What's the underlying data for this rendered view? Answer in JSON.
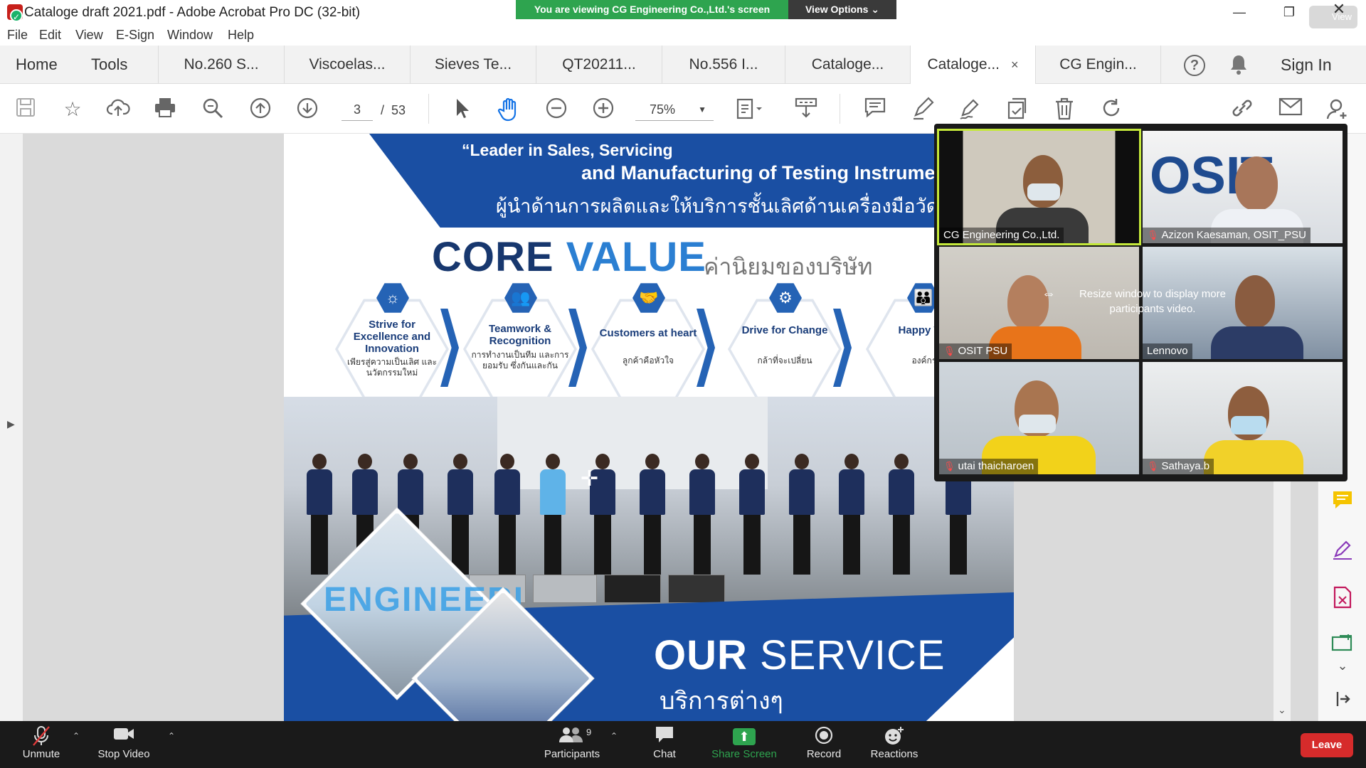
{
  "window": {
    "title": "Cataloge draft 2021.pdf - Adobe Acrobat Pro DC (32-bit)",
    "view_label": "View"
  },
  "zoom_banner": {
    "viewing_text": "You are viewing CG Engineering Co.,Ltd.'s screen",
    "view_options_label": "View Options ⌄"
  },
  "menu": [
    "File",
    "Edit",
    "View",
    "E-Sign",
    "Window",
    "Help"
  ],
  "tabs": {
    "home": "Home",
    "tools": "Tools",
    "documents": [
      "No.260 S...",
      "Viscoelas...",
      "Sieves Te...",
      "QT20211...",
      "No.556 I...",
      "Cataloge...",
      "Cataloge...",
      "CG Engin..."
    ],
    "active_index": 6,
    "close_symbol": "×",
    "sign_in": "Sign In"
  },
  "toolbar": {
    "current_page": "3",
    "page_separator": "/",
    "total_pages": "53",
    "zoom_level": "75%"
  },
  "pdf": {
    "slogan_line1": "“Leader in Sales, Servicing",
    "slogan_line2": "and Manufacturing of Testing Instrume",
    "slogan_thai": "ผู้นำด้านการผลิตและให้บริการชั้นเลิศด้านเครื่องมือวัดทดสอบ",
    "core_word1": "CORE",
    "core_word2": "VALUE",
    "core_thai": "ค่านิยมของบริษัท",
    "values": [
      {
        "title": "Strive for Excellence and Innovation",
        "thai": "เพียรสู่ความเป็นเลิศ และนวัตกรรมใหม่"
      },
      {
        "title": "Teamwork & Recognition",
        "thai": "การทำงานเป็นทีม และการยอมรับ ซึ่งกันและกัน"
      },
      {
        "title": "Customers at heart",
        "thai": "ลูกค้าคือหัวใจ"
      },
      {
        "title": "Drive for Change",
        "thai": "กล้าที่จะเปลี่ยน"
      },
      {
        "title": "Happy Workpla",
        "thai": "องค์กรแห่งคว"
      }
    ],
    "engi_text": "ENGINEERI",
    "our_word": "OUR",
    "service_word": "SERVICE",
    "service_thai": "บริการต่างๆ"
  },
  "zoom_gallery": {
    "participants": [
      {
        "name": "CG Engineering Co.,Ltd.",
        "muted": false,
        "speaking": true
      },
      {
        "name": "Azizon Kaesaman, OSIT_PSU",
        "muted": true,
        "speaking": false
      },
      {
        "name": "OSIT PSU",
        "muted": true,
        "speaking": false
      },
      {
        "name": "Lennovo",
        "muted": false,
        "speaking": false
      },
      {
        "name": "utai thaicharoen",
        "muted": true,
        "speaking": false
      },
      {
        "name": "Sathaya.b",
        "muted": true,
        "speaking": false
      }
    ],
    "resize_message": "Resize window to display more participants video."
  },
  "zoom_bar": {
    "unmute": "Unmute",
    "stop_video": "Stop Video",
    "participants": "Participants",
    "participants_count": "9",
    "chat": "Chat",
    "share_screen": "Share Screen",
    "record": "Record",
    "reactions": "Reactions",
    "leave": "Leave"
  },
  "colors": {
    "brand_blue": "#1a4fa3",
    "zoom_green": "#2ea44f",
    "leave_red": "#d62b2b",
    "speaking_highlight": "#c4e83a"
  }
}
